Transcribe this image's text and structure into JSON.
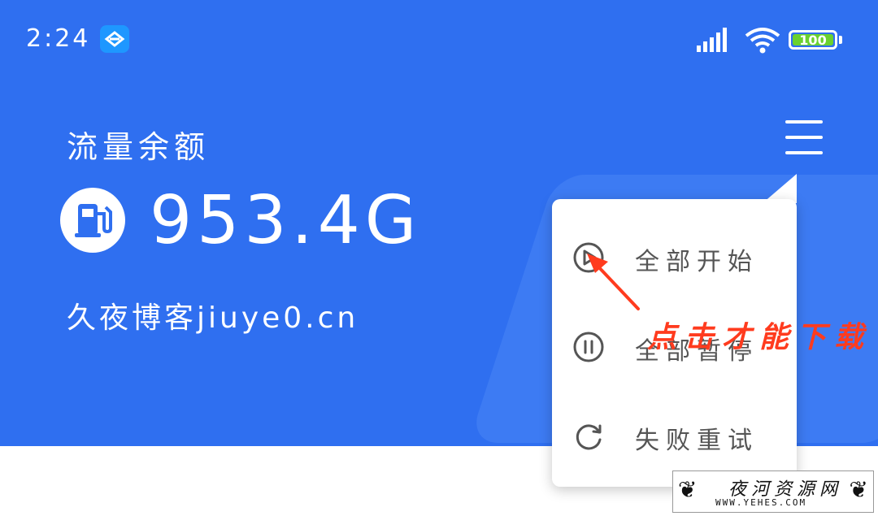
{
  "status_bar": {
    "time": "2:24",
    "battery": "100",
    "colors": {
      "battery_fill": "#6bd12e",
      "app_badge": "#1e97ff"
    }
  },
  "header": {
    "label": "流量余额",
    "amount": "953.4G",
    "blog": "久夜博客jiuye0.cn",
    "background": "#2f6ff0"
  },
  "popup_menu": {
    "items": [
      {
        "icon": "play-icon",
        "label": "全部开始"
      },
      {
        "icon": "pause-icon",
        "label": "全部暂停"
      },
      {
        "icon": "refresh-icon",
        "label": "失败重试"
      }
    ]
  },
  "annotation": {
    "text": "点击才能下载",
    "color": "#ff3b1e"
  },
  "watermark": {
    "main": "夜河资源网",
    "sub": "WWW.YEHES.COM"
  }
}
